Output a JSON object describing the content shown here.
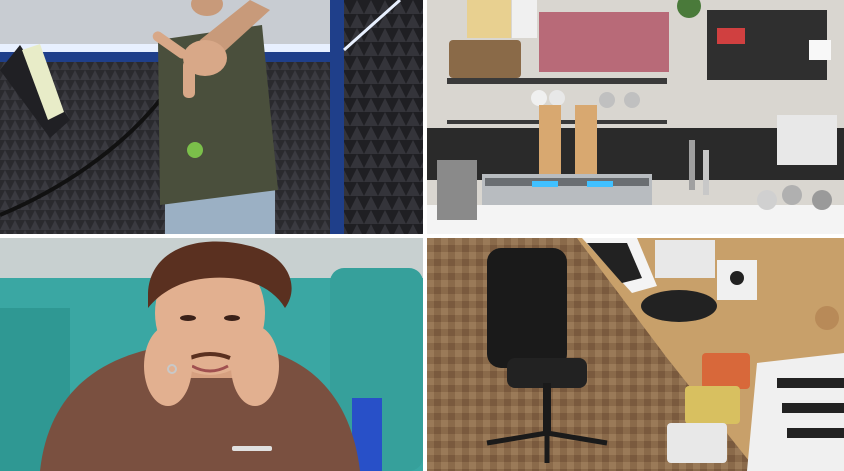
{
  "post_media": {
    "photo_count": 4,
    "photos": [
      {
        "subject": "man-in-acoustic-booth"
      },
      {
        "subject": "coffee-bar-kitchen"
      },
      {
        "subject": "young-man-hands-on-cheeks"
      },
      {
        "subject": "music-studio-desk"
      }
    ]
  },
  "colors": {
    "booth_foam": "#2a2a2e",
    "booth_blue": "#1f3f8a",
    "kitchen_wall": "#d9d6d0",
    "sofa_teal": "#3aa7a3",
    "wood_desk": "#c8a06a"
  }
}
